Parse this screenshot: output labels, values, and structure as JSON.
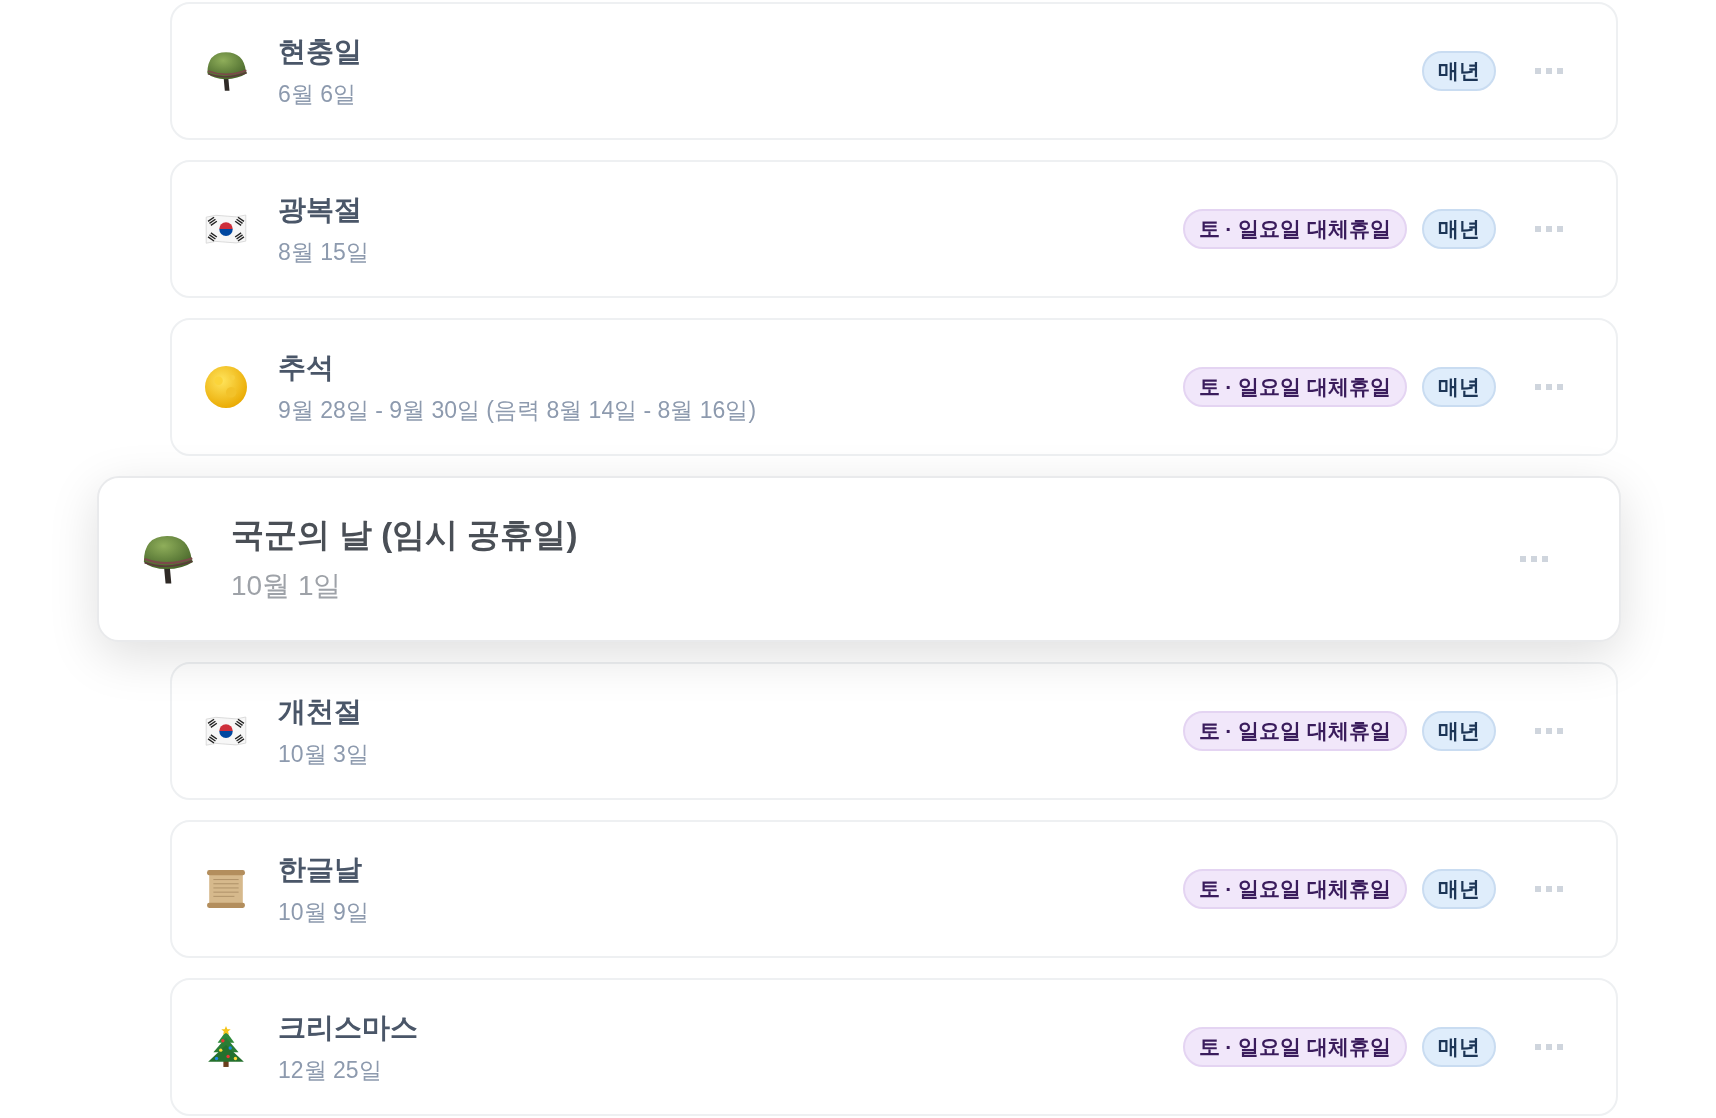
{
  "holidays": [
    {
      "name": "현충일",
      "date": "6월 6일",
      "dragging": false,
      "tags": [
        {
          "label": "매년",
          "kind": "recurrence"
        }
      ]
    },
    {
      "name": "광복절",
      "date": "8월 15일",
      "dragging": false,
      "tags": [
        {
          "label": "토 · 일요일 대체휴일",
          "kind": "substitute"
        },
        {
          "label": "매년",
          "kind": "recurrence"
        }
      ]
    },
    {
      "name": "추석",
      "date": "9월 28일 - 9월 30일 (음력 8월 14일 - 8월 16일)",
      "dragging": false,
      "tags": [
        {
          "label": "토 · 일요일 대체휴일",
          "kind": "substitute"
        },
        {
          "label": "매년",
          "kind": "recurrence"
        }
      ]
    },
    {
      "name": "국군의 날 (임시 공휴일)",
      "date": "10월 1일",
      "dragging": true
    },
    {
      "name": "개천절",
      "date": "10월 3일",
      "dragging": false,
      "tags": [
        {
          "label": "토 · 일요일 대체휴일",
          "kind": "substitute"
        },
        {
          "label": "매년",
          "kind": "recurrence"
        }
      ]
    },
    {
      "name": "한글날",
      "date": "10월 9일",
      "dragging": false,
      "tags": [
        {
          "label": "토 · 일요일 대체휴일",
          "kind": "substitute"
        },
        {
          "label": "매년",
          "kind": "recurrence"
        }
      ]
    },
    {
      "name": "크리스마스",
      "date": "12월 25일",
      "dragging": false,
      "tags": [
        {
          "label": "토 · 일요일 대체휴일",
          "kind": "substitute"
        },
        {
          "label": "매년",
          "kind": "recurrence"
        }
      ]
    }
  ]
}
